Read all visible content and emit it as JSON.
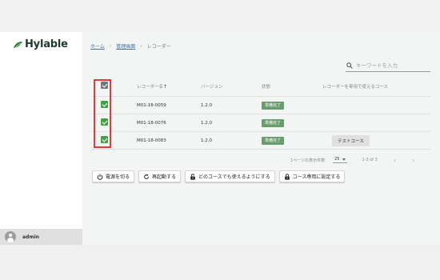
{
  "app": {
    "brand": "Hylable",
    "brand_color": "#2e7d32"
  },
  "user": {
    "name": "admin"
  },
  "breadcrumb": {
    "home": "ホーム",
    "sep": "›",
    "admin": "管理画面",
    "current": "レコーダー"
  },
  "search": {
    "placeholder": "キーワードを入力",
    "value": ""
  },
  "table": {
    "headers": {
      "name": "レコーダー名",
      "sort": "↑",
      "version": "バージョン",
      "status": "状態",
      "course": "レコーダーを専用で使えるコース"
    },
    "rows": [
      {
        "name": "M01-18-0059",
        "version": "1.2.0",
        "status": "準備完了",
        "course": ""
      },
      {
        "name": "M01-18-0076",
        "version": "1.2.0",
        "status": "準備完了",
        "course": ""
      },
      {
        "name": "M01-18-0083",
        "version": "1.2.0",
        "status": "準備完了",
        "course": "テストコース"
      }
    ]
  },
  "pagination": {
    "rows_label": "1ページの表示件数",
    "rows_per_page": "25",
    "range": "1-3 of 3",
    "prev": "‹",
    "next": "›"
  },
  "actions": {
    "power_off": "電源を切る",
    "restart": "再起動する",
    "any_course": "どのコースでも使えるようにする",
    "dedicated": "コース専用に設定する"
  },
  "colors": {
    "accent": "#43a047",
    "badge": "#6a9c6e",
    "highlight": "#e53935"
  }
}
